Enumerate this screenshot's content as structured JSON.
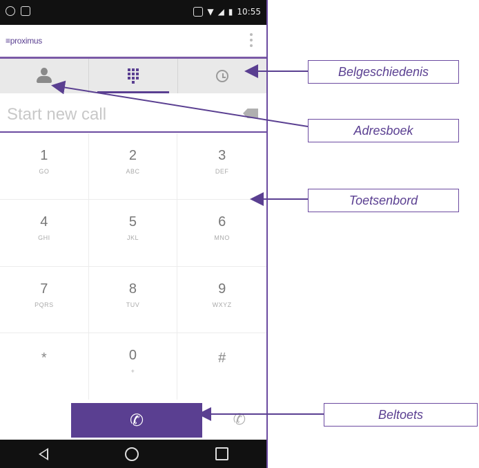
{
  "statusbar": {
    "time": "10:55"
  },
  "app": {
    "logo": "proximus"
  },
  "tabs": [
    {
      "name": "contacts",
      "icon": "person-icon"
    },
    {
      "name": "dialpad",
      "icon": "dialpad-icon",
      "active": true
    },
    {
      "name": "history",
      "icon": "clock-icon"
    }
  ],
  "call_input": {
    "placeholder": "Start new call",
    "value": ""
  },
  "keys": [
    {
      "num": "1",
      "letters": "GO"
    },
    {
      "num": "2",
      "letters": "ABC"
    },
    {
      "num": "3",
      "letters": "DEF"
    },
    {
      "num": "4",
      "letters": "GHI"
    },
    {
      "num": "5",
      "letters": "JKL"
    },
    {
      "num": "6",
      "letters": "MNO"
    },
    {
      "num": "7",
      "letters": "PQRS"
    },
    {
      "num": "8",
      "letters": "TUV"
    },
    {
      "num": "9",
      "letters": "WXYZ"
    },
    {
      "num": "*",
      "letters": ""
    },
    {
      "num": "0",
      "letters": "+"
    },
    {
      "num": "#",
      "letters": ""
    }
  ],
  "callouts": {
    "belgeschiedenis": "Belgeschiedenis",
    "adresboek": "Adresboek",
    "toetsenbord": "Toetsenbord",
    "beltoets": "Beltoets"
  },
  "colors": {
    "brand": "#5a3f91",
    "statusbar": "#111111"
  }
}
